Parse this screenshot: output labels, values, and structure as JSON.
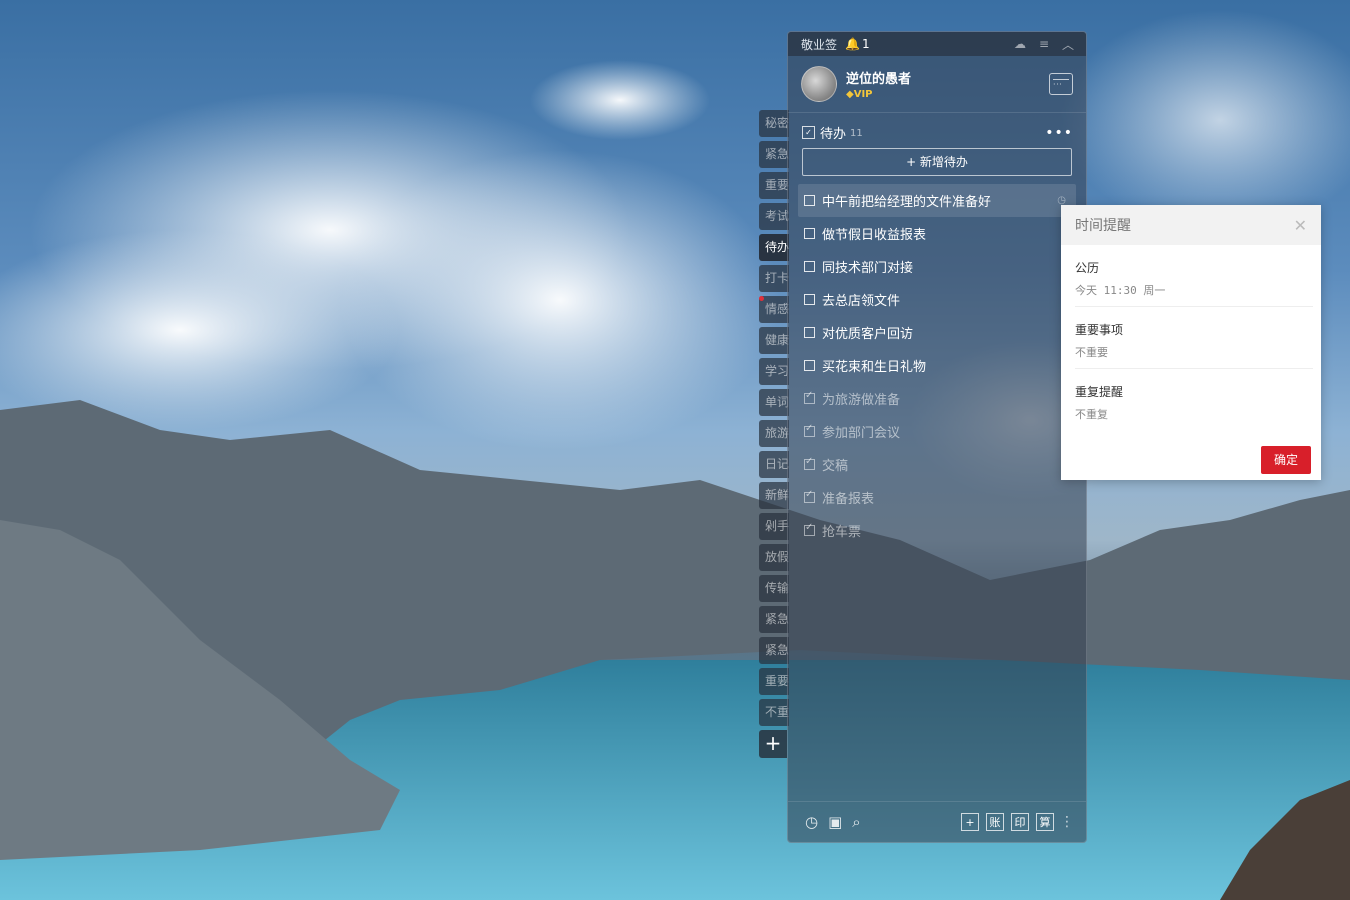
{
  "app": {
    "title": "敬业签",
    "notification_count": "1",
    "titlebar_icons": [
      "cloud-sync-icon",
      "menu-icon",
      "collapse-icon"
    ]
  },
  "profile": {
    "name": "逆位的愚者",
    "badge": "VIP"
  },
  "tabs": [
    {
      "label": "秘密"
    },
    {
      "label": "紧急"
    },
    {
      "label": "重要"
    },
    {
      "label": "考试"
    },
    {
      "label": "待办",
      "active": true
    },
    {
      "label": "打卡"
    },
    {
      "label": "情感"
    },
    {
      "label": "健康"
    },
    {
      "label": "学习"
    },
    {
      "label": "单词"
    },
    {
      "label": "旅游"
    },
    {
      "label": "日记"
    },
    {
      "label": "新鲜"
    },
    {
      "label": "剁手"
    },
    {
      "label": "放假"
    },
    {
      "label": "传输"
    },
    {
      "label": "紧急"
    },
    {
      "label": "紧急"
    },
    {
      "label": "重要"
    },
    {
      "label": "不重"
    }
  ],
  "tab_add_label": "+",
  "section": {
    "title": "待办",
    "count": "11",
    "new_button": "+ 新增待办"
  },
  "todos": [
    {
      "label": "中午前把给经理的文件准备好",
      "done": false,
      "highlighted": true
    },
    {
      "label": "做节假日收益报表",
      "done": false
    },
    {
      "label": "同技术部门对接",
      "done": false
    },
    {
      "label": "去总店领文件",
      "done": false
    },
    {
      "label": "对优质客户回访",
      "done": false
    },
    {
      "label": "买花束和生日礼物",
      "done": false
    },
    {
      "label": "为旅游做准备",
      "done": true
    },
    {
      "label": "参加部门会议",
      "done": true
    },
    {
      "label": "交稿",
      "done": true
    },
    {
      "label": "准备报表",
      "done": true
    },
    {
      "label": "抢车票",
      "done": true
    }
  ],
  "footer": {
    "left_icons": [
      "clock-icon",
      "archive-icon",
      "search-icon"
    ],
    "right_buttons": [
      "+",
      "账",
      "印",
      "算"
    ]
  },
  "reminder_popup": {
    "title": "时间提醒",
    "rows": [
      {
        "label": "公历",
        "value": "今天 11:30 周一"
      },
      {
        "label": "重要事项",
        "value": "不重要"
      },
      {
        "label": "重复提醒",
        "value": "不重复"
      }
    ],
    "confirm": "确定"
  },
  "colors": {
    "accent_red": "#d81f2a",
    "vip_gold": "#f3c63a"
  }
}
